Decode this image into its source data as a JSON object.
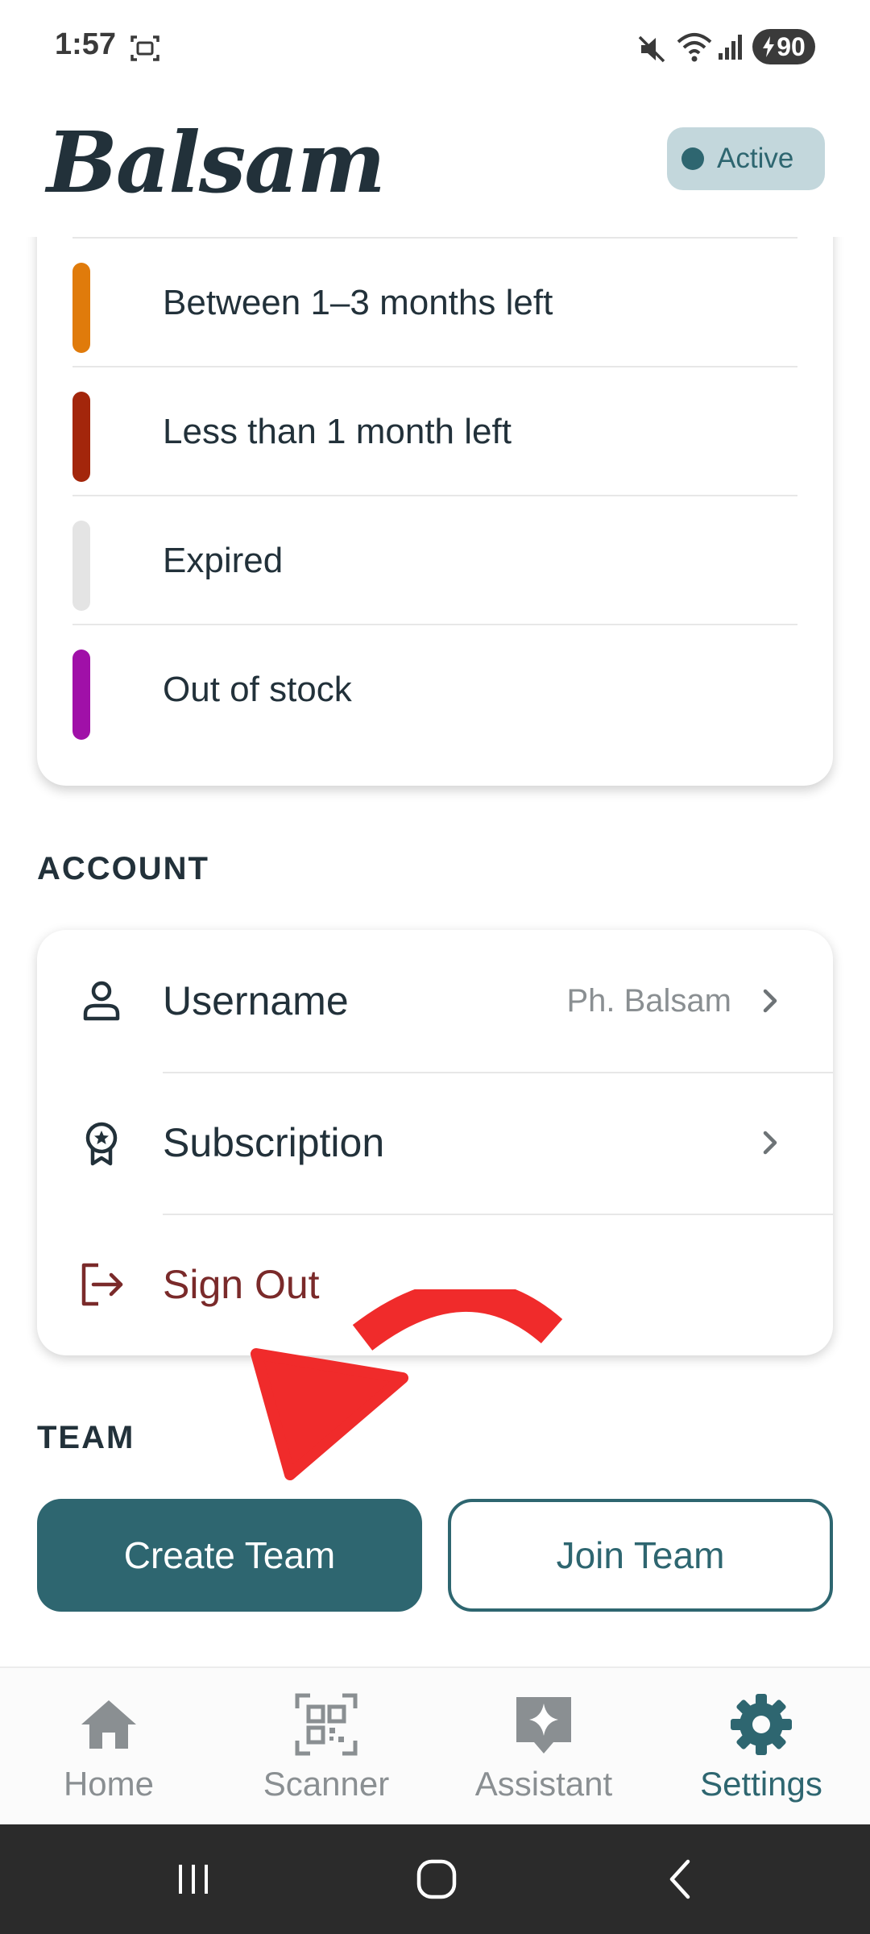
{
  "status_bar": {
    "time": "1:57",
    "battery": "90"
  },
  "header": {
    "logo": "Balsam",
    "status_badge": "Active"
  },
  "legend": {
    "items": [
      {
        "label": "Between 1–3 months left",
        "color": "#e07b0b"
      },
      {
        "label": "Less than 1 month left",
        "color": "#a3260b"
      },
      {
        "label": "Expired",
        "color": "#e4e4e4"
      },
      {
        "label": "Out of stock",
        "color": "#a010a8"
      }
    ]
  },
  "account": {
    "section_label": "ACCOUNT",
    "rows": [
      {
        "label": "Username",
        "value": "Ph. Balsam",
        "icon": "person-icon"
      },
      {
        "label": "Subscription",
        "value": "",
        "icon": "award-badge-icon"
      },
      {
        "label": "Sign Out",
        "value": "",
        "icon": "sign-out-icon"
      }
    ]
  },
  "team": {
    "section_label": "TEAM",
    "create_label": "Create Team",
    "join_label": "Join Team"
  },
  "bottom_nav": {
    "items": [
      {
        "label": "Home",
        "icon": "home-icon"
      },
      {
        "label": "Scanner",
        "icon": "qr-scanner-icon"
      },
      {
        "label": "Assistant",
        "icon": "sparkle-chat-icon"
      },
      {
        "label": "Settings",
        "icon": "gear-icon",
        "active": true
      }
    ]
  },
  "colors": {
    "accent": "#2e6670",
    "danger_text": "#7a2a2a",
    "annotation_arrow": "#f02b2b"
  }
}
